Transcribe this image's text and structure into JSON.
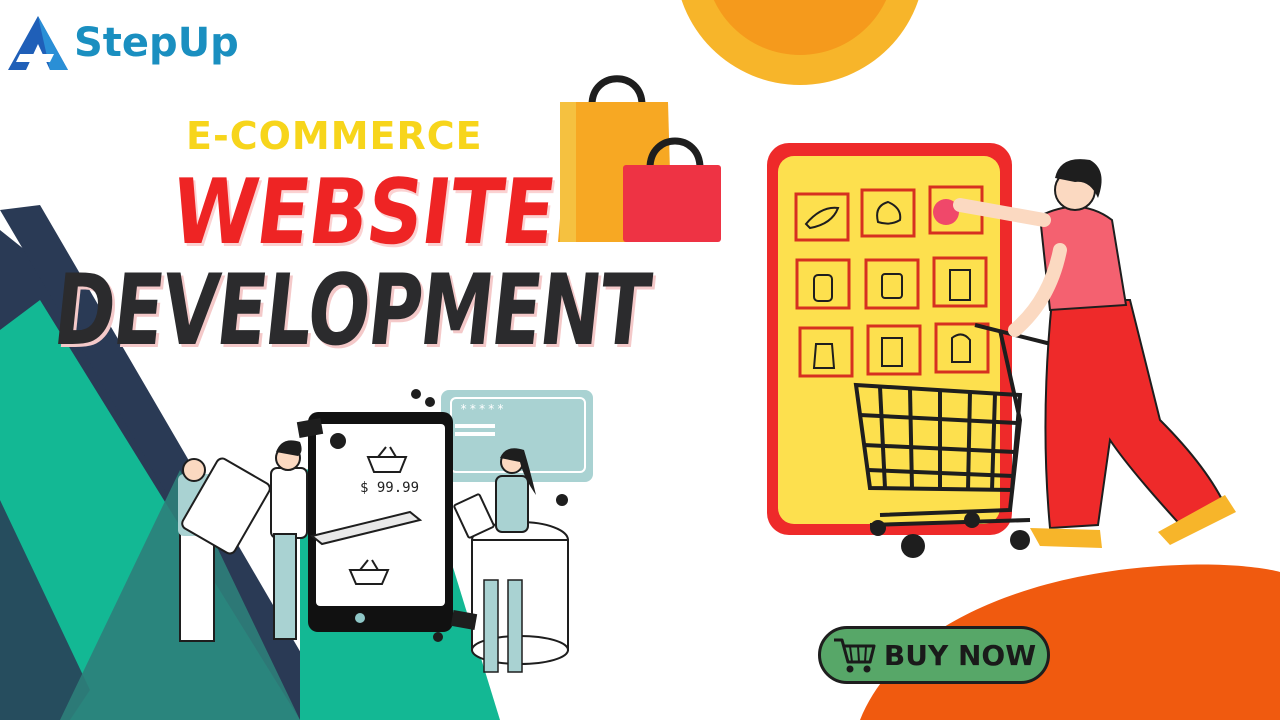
{
  "brand": {
    "name": "StepUp",
    "logo_icon": "triangle-arrow-logo",
    "colors": {
      "primary": "#1a8fc0",
      "accent_blue": "#1f3f9a"
    }
  },
  "headline": {
    "eyebrow": "E-COMMERCE",
    "line1": "WEBSITE",
    "line2": "DEVELOPMENT",
    "colors": {
      "eyebrow": "#f7d51b",
      "line1": "#ee2424",
      "line2": "#2b2b2d"
    }
  },
  "phone_illustration": {
    "price": "$ 99.99",
    "password_mask": "*****",
    "icons": [
      "basket-icon",
      "card-icon",
      "dollar-bill-icon",
      "minus-icon"
    ]
  },
  "cta": {
    "label": "BUY NOW",
    "icon": "shopping-cart-icon",
    "colors": {
      "background": "#57a768",
      "border": "#1e1e1e"
    }
  },
  "palette": {
    "teal": "#13b894",
    "navy": "#2a3a55",
    "orange": "#f05a0f",
    "yellow": "#ffe14d",
    "red": "#ee3333"
  }
}
